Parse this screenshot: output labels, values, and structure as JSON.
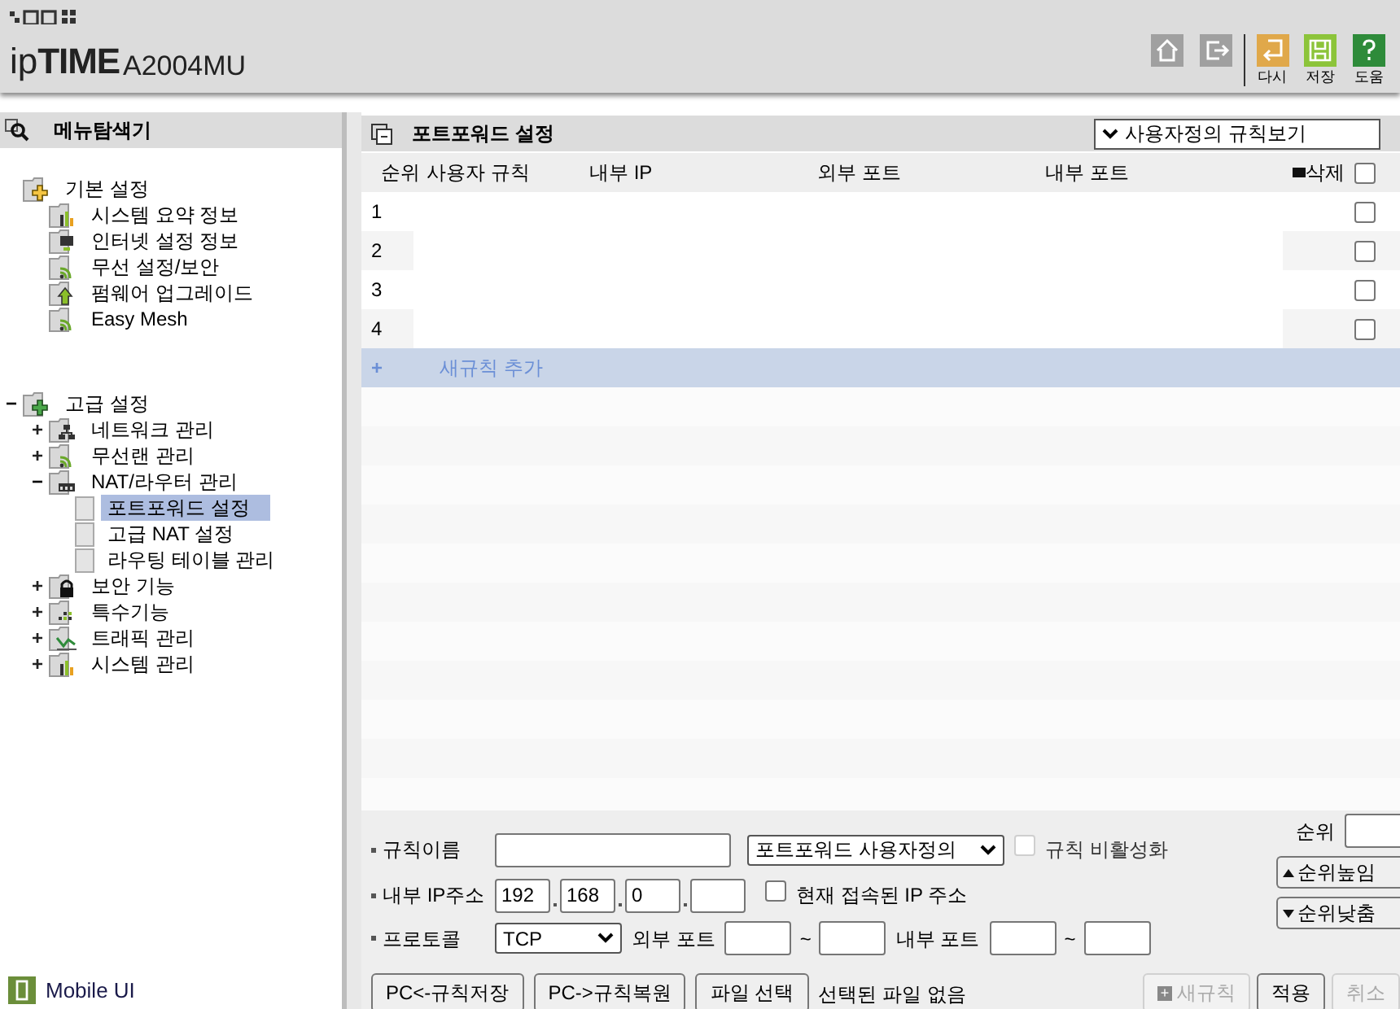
{
  "header": {
    "brand_prefix": "ip",
    "brand_main": "TIME",
    "model": "A2004MU",
    "toolbar": [
      {
        "kind": "home"
      },
      {
        "kind": "logout"
      },
      {
        "kind": "redo",
        "label": "다시"
      },
      {
        "kind": "save",
        "label": "저장"
      },
      {
        "kind": "help",
        "label": "도움"
      }
    ]
  },
  "sidebar": {
    "title": "메뉴탐색기",
    "tree": [
      {
        "label": "기본 설정",
        "kind": "folder-yellow",
        "selected": false,
        "children": [
          {
            "label": "시스템 요약 정보",
            "kind": "chart",
            "selected": false
          },
          {
            "label": "인터넷 설정 정보",
            "kind": "monitor",
            "selected": false
          },
          {
            "label": "무선 설정/보안",
            "kind": "wifi",
            "selected": false
          },
          {
            "label": "펌웨어 업그레이드",
            "kind": "upgrade",
            "selected": false
          },
          {
            "label": "Easy Mesh",
            "kind": "wifi",
            "selected": false
          }
        ]
      },
      {
        "label": "고급 설정",
        "kind": "folder-green",
        "expanded": true,
        "toggle": "−",
        "selected": false,
        "children": [
          {
            "label": "네트워크 관리",
            "kind": "network",
            "expanded": false,
            "toggle": "+",
            "selected": false
          },
          {
            "label": "무선랜 관리",
            "kind": "wifi",
            "expanded": false,
            "toggle": "+",
            "selected": false
          },
          {
            "label": "NAT/라우터 관리",
            "kind": "router",
            "expanded": true,
            "toggle": "−",
            "selected": false,
            "children": [
              {
                "label": "포트포워드 설정",
                "kind": "page",
                "selected": true
              },
              {
                "label": "고급 NAT 설정",
                "kind": "page",
                "selected": false
              },
              {
                "label": "라우팅 테이블 관리",
                "kind": "page",
                "selected": false
              }
            ]
          },
          {
            "label": "보안 기능",
            "kind": "lock",
            "expanded": false,
            "toggle": "+",
            "selected": false
          },
          {
            "label": "특수기능",
            "kind": "grid",
            "expanded": false,
            "toggle": "+",
            "selected": false
          },
          {
            "label": "트래픽 관리",
            "kind": "traffic",
            "expanded": false,
            "toggle": "+",
            "selected": false
          },
          {
            "label": "시스템 관리",
            "kind": "chart",
            "expanded": false,
            "toggle": "+",
            "selected": false
          }
        ]
      }
    ],
    "footer_link": "Mobile UI"
  },
  "panel": {
    "title": "포트포워드 설정",
    "view_select": "사용자정의 규칙보기",
    "columns": [
      "순위",
      "사용자 규칙",
      "내부 IP",
      "외부 포트",
      "내부 포트",
      "삭제"
    ],
    "select_all_checked": false,
    "rows": [
      {
        "rank": "1",
        "checked": false
      },
      {
        "rank": "2",
        "checked": false
      },
      {
        "rank": "3",
        "checked": false
      },
      {
        "rank": "4",
        "checked": false
      }
    ],
    "add_row": {
      "icon": "+",
      "label": "새규칙 추가"
    }
  },
  "form": {
    "rule_name": {
      "label": "규칙이름"
    },
    "rule_type": "포트포워드 사용자정의",
    "disable_rule": {
      "label": "규칙 비활성화",
      "checked": false,
      "disabled": true
    },
    "internal_ip": {
      "label": "내부 IP주소",
      "octets": [
        "192",
        "168",
        "0"
      ]
    },
    "current_ip": {
      "label": "현재 접속된 IP 주소",
      "checked": false
    },
    "protocol": {
      "label": "프로토콜",
      "value": "TCP"
    },
    "external_port": {
      "label": "외부 포트",
      "separator": "~"
    },
    "internal_port": {
      "label": "내부 포트",
      "separator": "~"
    },
    "rank": {
      "label": "순위"
    },
    "rank_up": "순위높임",
    "rank_down": "순위낮춤",
    "buttons": [
      {
        "label": "PC<-규칙저장",
        "disabled": false
      },
      {
        "label": "PC->규칙복원",
        "disabled": false
      },
      {
        "label": "파일 선택",
        "disabled": false
      }
    ],
    "file_status": "선택된 파일 없음",
    "actions": [
      {
        "label": "새규칙",
        "icon": "+",
        "disabled": true
      },
      {
        "label": "적용",
        "disabled": false
      },
      {
        "label": "취소",
        "disabled": true
      }
    ]
  }
}
